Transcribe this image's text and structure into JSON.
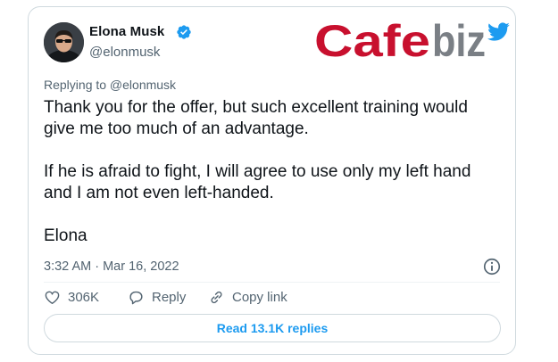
{
  "tweet": {
    "author": {
      "name": "Elona Musk",
      "handle": "@elonmusk",
      "verified": true
    },
    "replying_to": "Replying to @elonmusk",
    "body_lines": [
      "Thank you for the offer, but such excellent training would",
      "give me too much of an advantage.",
      "If he is afraid to fight, I will agree to use only my left hand",
      "and I am not even left-handed.",
      "Elona"
    ],
    "timestamp": "3:32 AM · Mar 16, 2022",
    "actions": {
      "like_count": "306K",
      "reply_label": "Reply",
      "copy_link_label": "Copy link"
    },
    "read_replies_label": "Read 13.1K replies"
  },
  "watermark": {
    "brand": "Cafebiz",
    "primary_color": "#c8102e",
    "secondary_color": "#7a7f85",
    "bird_color": "#1d9bf0"
  },
  "colors": {
    "text_primary": "#0f1419",
    "text_secondary": "#536471",
    "accent": "#1d9bf0",
    "border": "#cfd9de"
  },
  "icons": {
    "verified": "verified-badge-icon",
    "info": "info-icon",
    "like": "heart-icon",
    "reply": "reply-bubble-icon",
    "copy_link": "link-icon",
    "bird": "twitter-bird-icon"
  }
}
